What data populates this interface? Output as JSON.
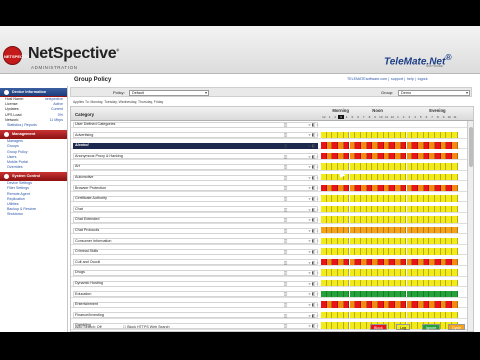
{
  "app": {
    "brand": "NetSpective",
    "brand_mark": "®",
    "brand_sub": "ADMINISTRATION",
    "logo_circle": "NETSPECTIVE",
    "partner": "TeleMate.Net",
    "partner_mark": "®",
    "partner_sub": "SOFTWARE",
    "links": [
      "TELEMATEsoftware.com",
      "support",
      "help",
      "logout"
    ]
  },
  "sidebar": {
    "device_info": {
      "title": "Device Information",
      "rows": [
        {
          "k": "Host Name:",
          "v": "netspective"
        },
        {
          "k": "License:",
          "v": "Active"
        },
        {
          "k": "Updates:",
          "v": "Current"
        },
        {
          "k": "UPS Load:",
          "v": "0%"
        },
        {
          "k": "Network:",
          "v": "11 Mbps"
        }
      ],
      "links": [
        "Statistics",
        "Reports"
      ]
    },
    "management": {
      "title": "Management",
      "items": [
        "Managers",
        "Groups",
        "Group Policy",
        "Users",
        "Mobile Portal",
        "Overrides"
      ]
    },
    "system": {
      "title": "System Control",
      "items": [
        "Device Settings",
        "Filter Settings",
        "Remote Agent",
        "Replication",
        "Utilities",
        "Backup & Restore",
        "Shutdown"
      ]
    }
  },
  "main": {
    "title": "Group Policy",
    "policy_label": "Policy:",
    "policy_value": "Default",
    "group_label": "Group:",
    "group_value": "Demo",
    "days": "Applies To: Monday, Tuesday, Wednesday, Thursday, Friday",
    "cat_header": "Category",
    "periods": [
      "Morning",
      "Noon",
      "Evening"
    ],
    "hours": [
      "12",
      "1",
      "2",
      "3",
      "4",
      "5",
      "6",
      "7",
      "8",
      "9",
      "10",
      "11",
      "12",
      "1",
      "2",
      "3",
      "4",
      "5",
      "6",
      "7",
      "8",
      "9",
      "10",
      "11"
    ],
    "current_hour_index": 3
  },
  "colors": {
    "block": "#e8141a",
    "log": "#f2ea1a",
    "ignore": "#25a33a",
    "cycle": "#f5a31a",
    "block_accent": "#d91d1d"
  },
  "categories": [
    {
      "name": "User Defined Categories",
      "pattern": "none"
    },
    {
      "name": "Advertising",
      "pattern": "log"
    },
    {
      "name": "Alcohol",
      "pattern": "block",
      "highlight": true
    },
    {
      "name": "Anonymous Proxy & Hacking",
      "pattern": "block"
    },
    {
      "name": "Art",
      "pattern": "log"
    },
    {
      "name": "Automotive",
      "pattern": "log"
    },
    {
      "name": "Browser Protection",
      "pattern": "block"
    },
    {
      "name": "Certificate Authority",
      "pattern": "log"
    },
    {
      "name": "Chat",
      "pattern": "log"
    },
    {
      "name": "Chat Extended",
      "pattern": "log"
    },
    {
      "name": "Chat Protocols",
      "pattern": "cycle"
    },
    {
      "name": "Consumer Information",
      "pattern": "log"
    },
    {
      "name": "Criminal Skills",
      "pattern": "log"
    },
    {
      "name": "Cult and Occult",
      "pattern": "block"
    },
    {
      "name": "Drugs",
      "pattern": "log"
    },
    {
      "name": "Dynamic Hosting",
      "pattern": "log"
    },
    {
      "name": "Education",
      "pattern": "ignore"
    },
    {
      "name": "Entertainment",
      "pattern": "block"
    },
    {
      "name": "Finance/Investing",
      "pattern": "log"
    },
    {
      "name": "Gambling",
      "pattern": "log"
    }
  ],
  "footer": {
    "auto_search": "Auto Search: Off",
    "https_label": "Block HTTPS Web Search",
    "legend": [
      {
        "label": "Block",
        "key": "block"
      },
      {
        "label": "Log",
        "key": "log"
      },
      {
        "label": "Ignore",
        "key": "ignore"
      },
      {
        "label": "Cycle",
        "key": "cycle"
      }
    ]
  }
}
